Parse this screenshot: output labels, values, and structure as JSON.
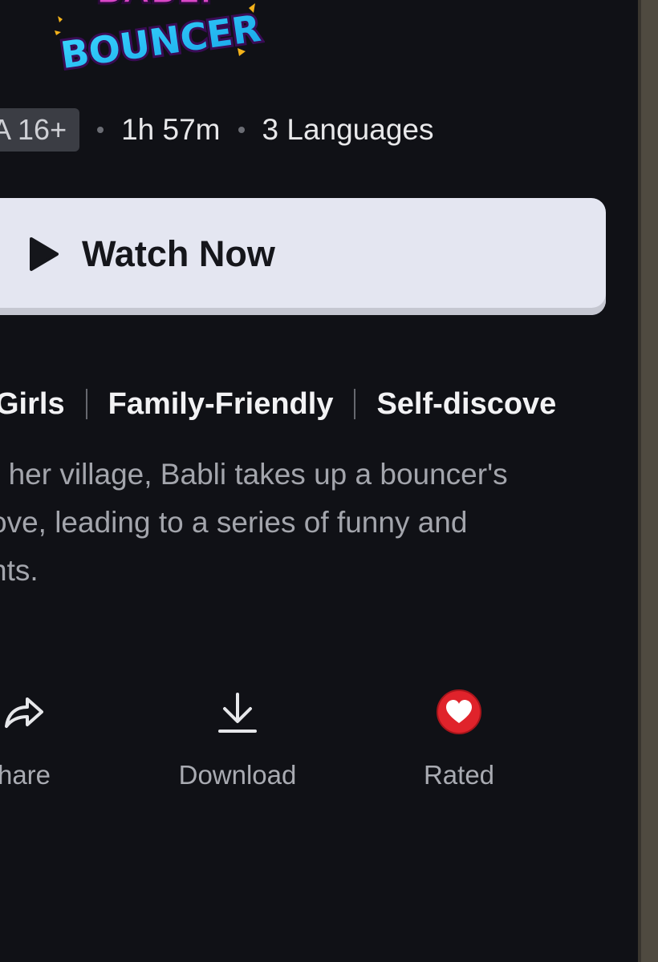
{
  "title_logo": {
    "line1": "BABLI",
    "line2": "BOUNCER"
  },
  "meta": {
    "age_rating": "A 16+",
    "duration": "1h 57m",
    "languages": "3 Languages"
  },
  "watch_button": {
    "label": "Watch Now",
    "icon": "play-icon"
  },
  "tags": [
    "Girls",
    "Family-Friendly",
    "Self-discove"
  ],
  "description_lines": [
    "r her village, Babli takes up a bouncer's",
    "ove, leading to a series of funny and",
    "nts."
  ],
  "actions": [
    {
      "label": "hare",
      "icon": "share-icon"
    },
    {
      "label": "Download",
      "icon": "download-icon"
    },
    {
      "label": "Rated",
      "icon": "heart-icon"
    }
  ],
  "colors": {
    "background": "#101116",
    "button_bg": "#e4e6f1",
    "heart_red": "#e0232b"
  }
}
